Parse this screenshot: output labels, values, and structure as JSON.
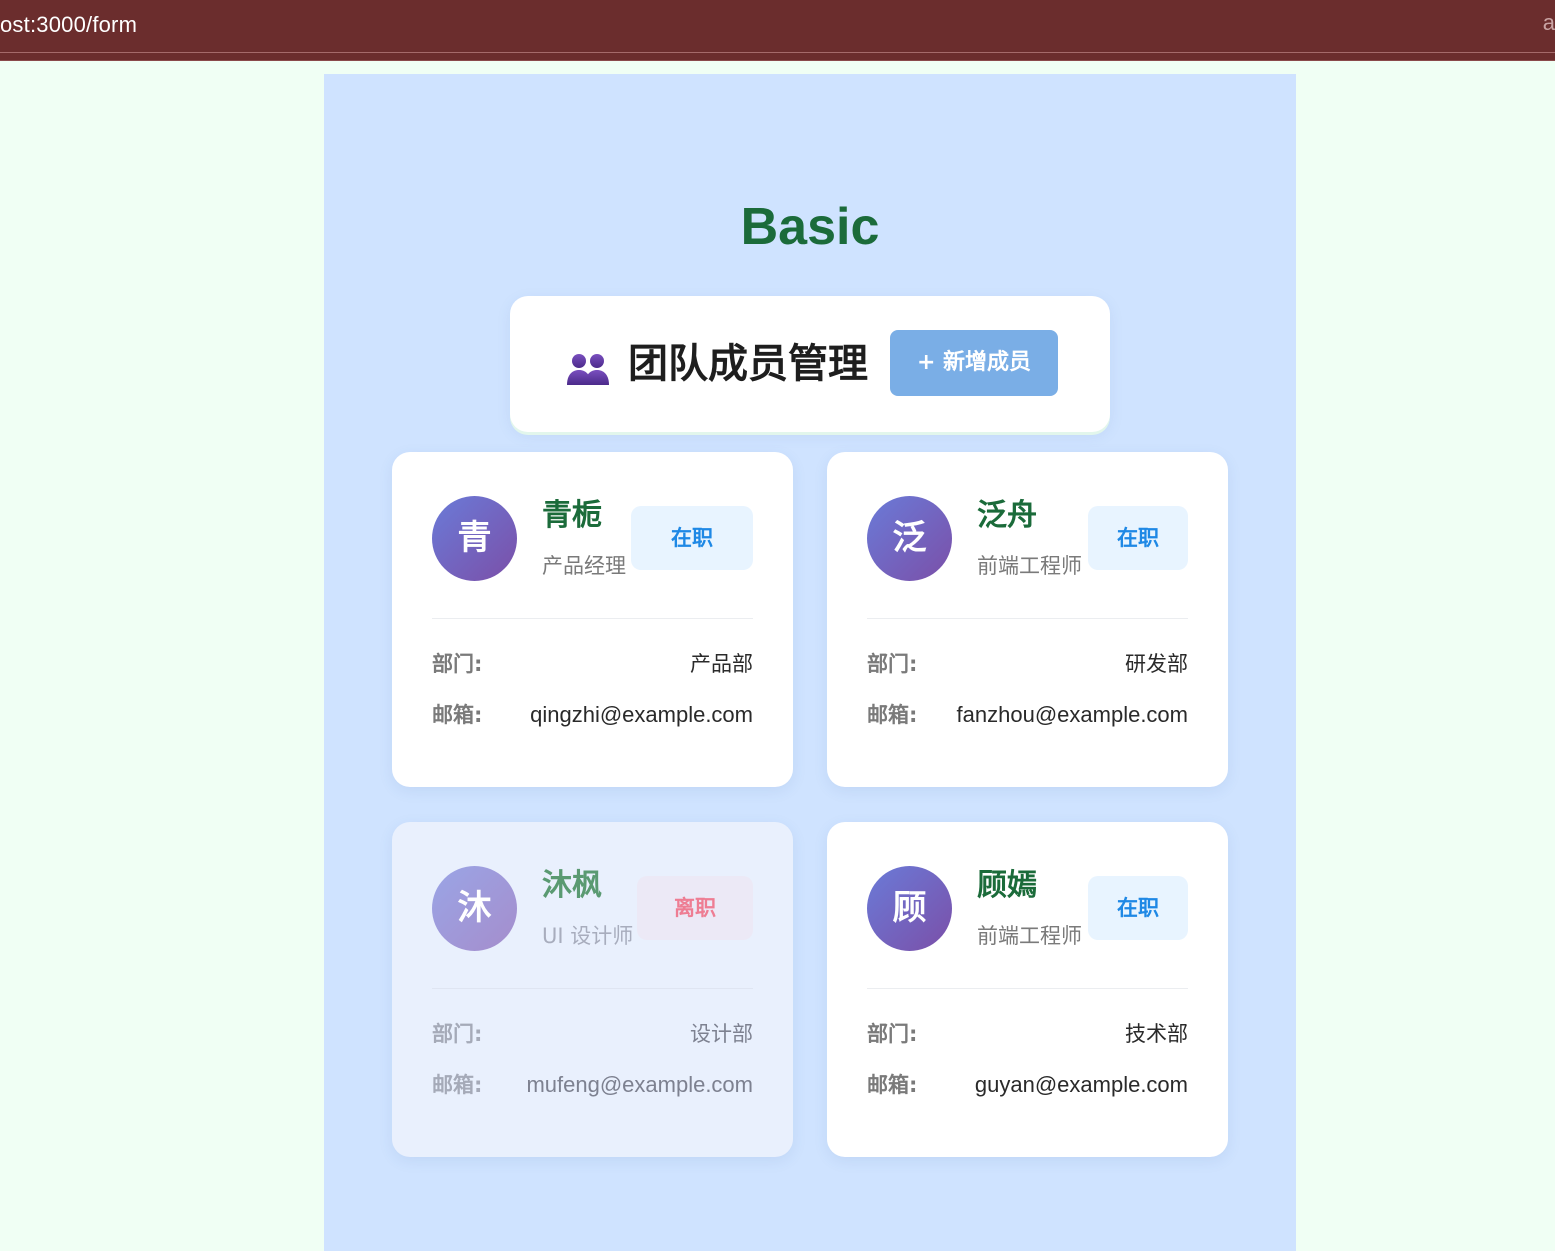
{
  "browser": {
    "url": "ost:3000/form",
    "right_glyph": "a"
  },
  "page": {
    "title": "Basic"
  },
  "header": {
    "title": "团队成员管理",
    "add_button_label": "+ 新增成员",
    "icon": "people-icon"
  },
  "labels": {
    "department": "部门:",
    "email": "邮箱:"
  },
  "members": [
    {
      "avatar_char": "青",
      "name": "青栀",
      "role": "产品经理",
      "status": "在职",
      "department": "产品部",
      "email": "qingzhi@example.com",
      "active": true
    },
    {
      "avatar_char": "泛",
      "name": "泛舟",
      "role": "前端工程师",
      "status": "在职",
      "department": "研发部",
      "email": "fanzhou@example.com",
      "active": true
    },
    {
      "avatar_char": "沐",
      "name": "沐枫",
      "role": "UI 设计师",
      "status": "离职",
      "department": "设计部",
      "email": "mufeng@example.com",
      "active": false
    },
    {
      "avatar_char": "顾",
      "name": "顾嫣",
      "role": "前端工程师",
      "status": "在职",
      "department": "技术部",
      "email": "guyan@example.com",
      "active": true
    }
  ],
  "colors": {
    "page_background": "#f0fff4",
    "panel_background": "#cfe3ff",
    "address_bar": "#6b2d2d",
    "title_green": "#1b6b3a",
    "add_button": "#7aaee6",
    "status_active_text": "#1e88e5",
    "status_left_text": "#ee7d93"
  }
}
